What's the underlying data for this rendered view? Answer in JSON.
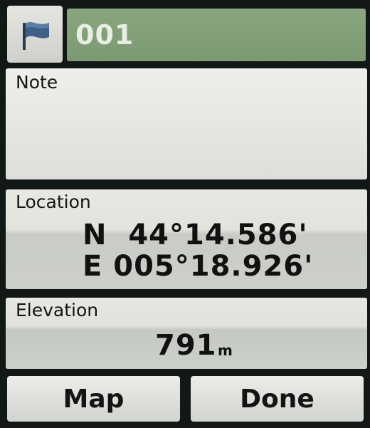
{
  "header": {
    "waypoint_icon": "flag-icon",
    "waypoint_name": "001"
  },
  "note": {
    "label": "Note",
    "value": ""
  },
  "location": {
    "label": "Location",
    "latitude": "N  44°14.586'",
    "longitude": "E 005°18.926'"
  },
  "elevation": {
    "label": "Elevation",
    "value": "791",
    "unit": "m"
  },
  "buttons": {
    "map_label": "Map",
    "done_label": "Done"
  },
  "colors": {
    "name_field_bg": "#7f9d76",
    "panel_bg": "#e6e6e1",
    "screen_bg": "#121815"
  }
}
